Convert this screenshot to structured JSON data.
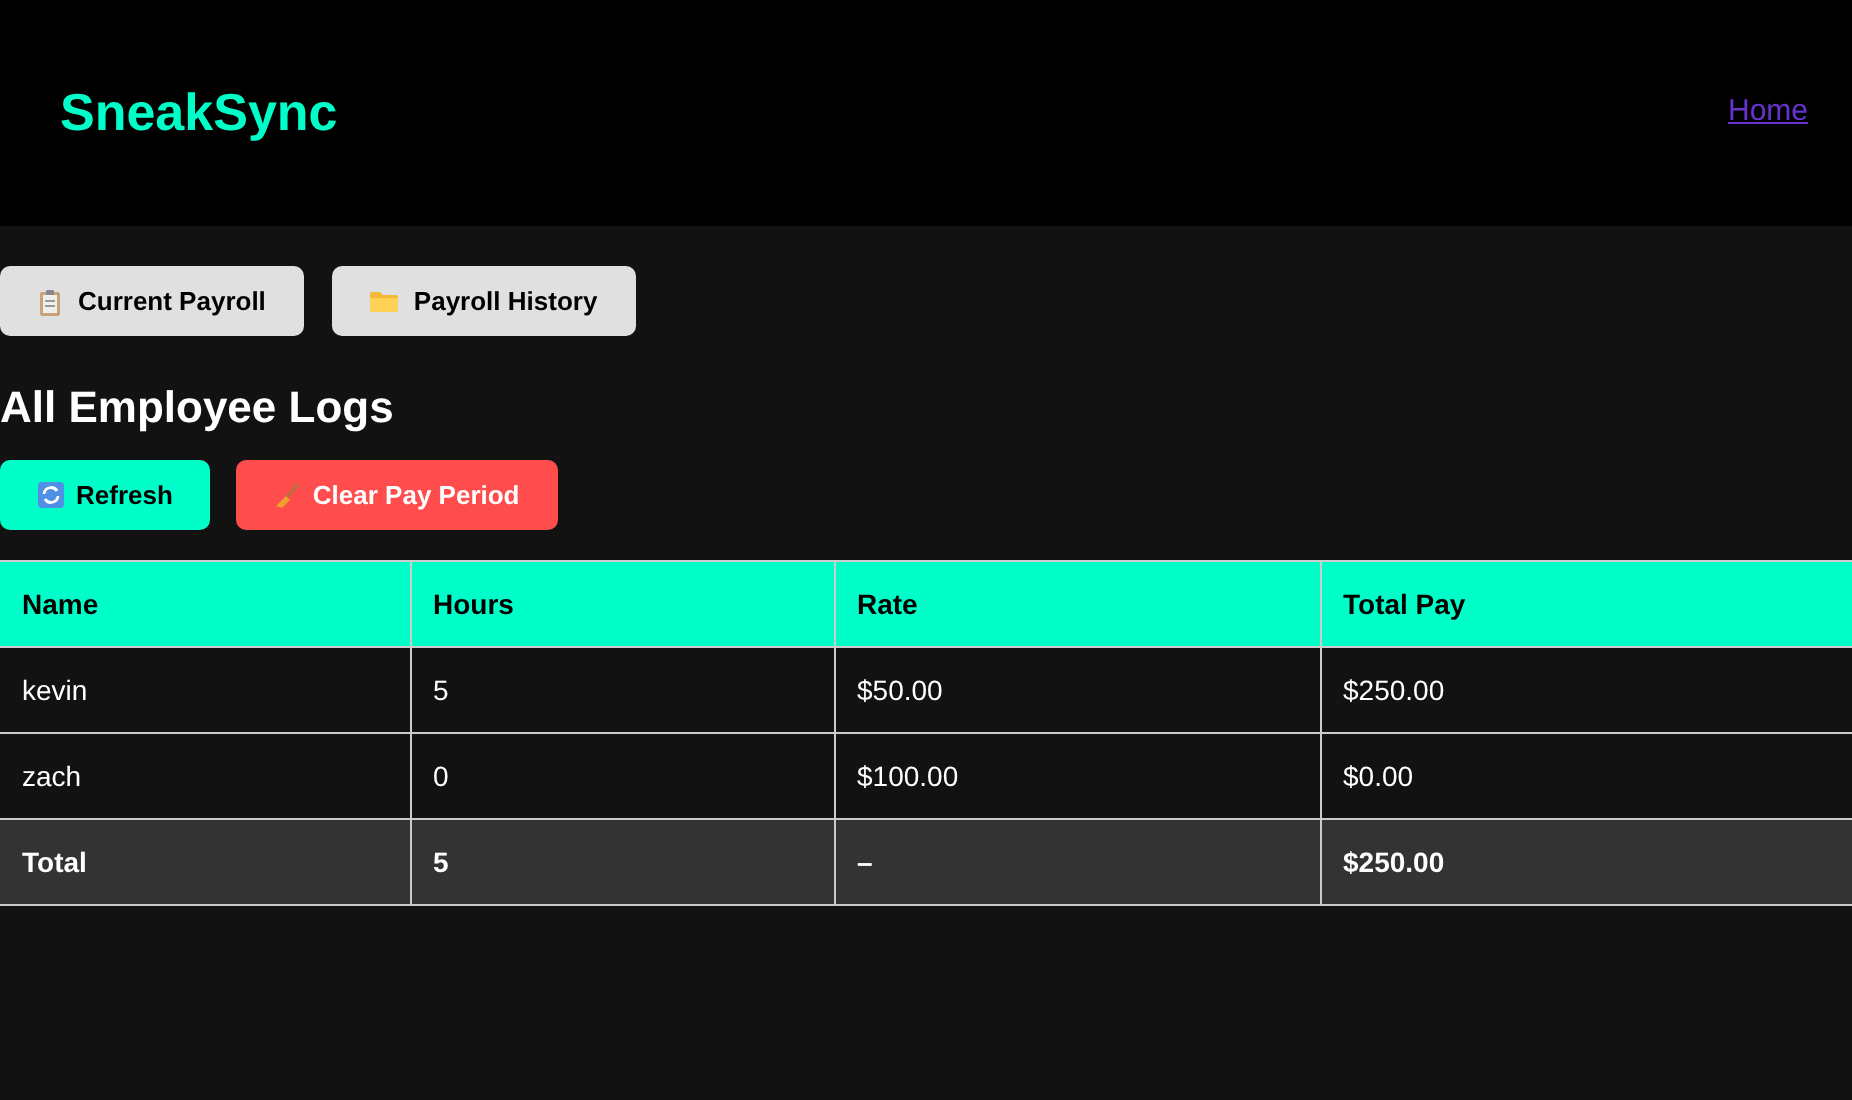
{
  "header": {
    "logo": "SneakSync",
    "nav_link": "Home"
  },
  "view_tabs": [
    {
      "label": "Current Payroll"
    },
    {
      "label": "Payroll History"
    }
  ],
  "heading": "All Employee Logs",
  "actions": [
    {
      "label": "Refresh",
      "kind": "refresh"
    },
    {
      "label": "Clear Pay Period",
      "kind": "danger"
    }
  ],
  "table": {
    "columns": [
      "Name",
      "Hours",
      "Rate",
      "Total Pay"
    ],
    "rows": [
      [
        "kevin",
        "5",
        "$50.00",
        "$250.00"
      ],
      [
        "zach",
        "0",
        "$100.00",
        "$0.00"
      ]
    ],
    "total_row": [
      "Total",
      "5",
      "–",
      "$250.00"
    ]
  }
}
